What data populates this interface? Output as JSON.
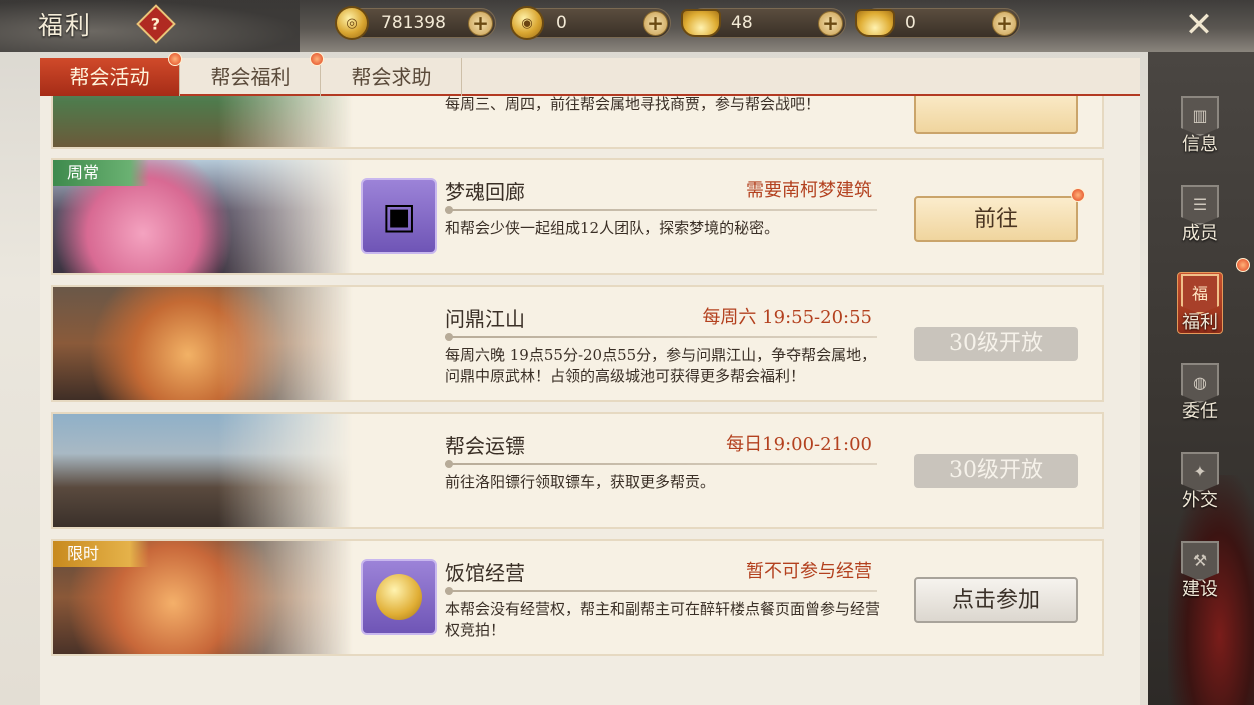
{
  "header": {
    "title": "福利",
    "help_symbol": "?",
    "close_symbol": "✕",
    "currencies": [
      {
        "icon": "copper-coin-icon",
        "value": "781398",
        "plus": "+"
      },
      {
        "icon": "gold-coin-icon",
        "value": "0",
        "plus": "+"
      },
      {
        "icon": "gold-ingot-icon",
        "value": "48",
        "plus": "+"
      },
      {
        "icon": "silver-ingot-icon",
        "value": "0",
        "plus": "+"
      }
    ]
  },
  "tabs": [
    {
      "label": "帮会活动",
      "active": true
    },
    {
      "label": "帮会福利",
      "active": false
    },
    {
      "label": "帮会求助",
      "active": false
    }
  ],
  "activities": [
    {
      "name": "",
      "requirement": "",
      "description": "每周三、周四，前往帮会属地寻找商贾，参与帮会战吧！",
      "button": ""
    },
    {
      "ribbon": "周常",
      "name": "梦魂回廊",
      "requirement": "需要南柯梦建筑",
      "description": "和帮会少侠一起组成12人团队，探索梦境的秘密。",
      "button": "前往",
      "reward_icon": "treasure-chest-icon"
    },
    {
      "name": "问鼎江山",
      "requirement": "每周六 19:55-20:55",
      "description": "每周六晚 19点55分-20点55分，参与问鼎江山，争夺帮会属地，问鼎中原武林！占领的高级城池可获得更多帮会福利！",
      "button": "30级开放"
    },
    {
      "name": "帮会运镖",
      "requirement": "每日19:00-21:00",
      "description": "前往洛阳镖行领取镖车，获取更多帮贡。",
      "button": "30级开放"
    },
    {
      "ribbon": "限时",
      "name": "饭馆经营",
      "requirement": "暂不可参与经营",
      "description": "本帮会没有经营权，帮主和副帮主可在醉轩楼点餐页面曾参与经营权竞拍！",
      "button": "点击参加",
      "reward_icon": "gold-medal-icon"
    }
  ],
  "sidebar": [
    {
      "label": "信息",
      "icon": "info-icon",
      "active": false
    },
    {
      "label": "成员",
      "icon": "members-icon",
      "active": false
    },
    {
      "label": "福利",
      "icon": "welfare-icon",
      "active": true
    },
    {
      "label": "委任",
      "icon": "appoint-icon",
      "active": false
    },
    {
      "label": "外交",
      "icon": "diplomacy-icon",
      "active": false
    },
    {
      "label": "建设",
      "icon": "build-icon",
      "active": false
    }
  ],
  "colors": {
    "accent": "#b33a22",
    "status": "#b3411f",
    "locked": "#c9c4bc"
  }
}
